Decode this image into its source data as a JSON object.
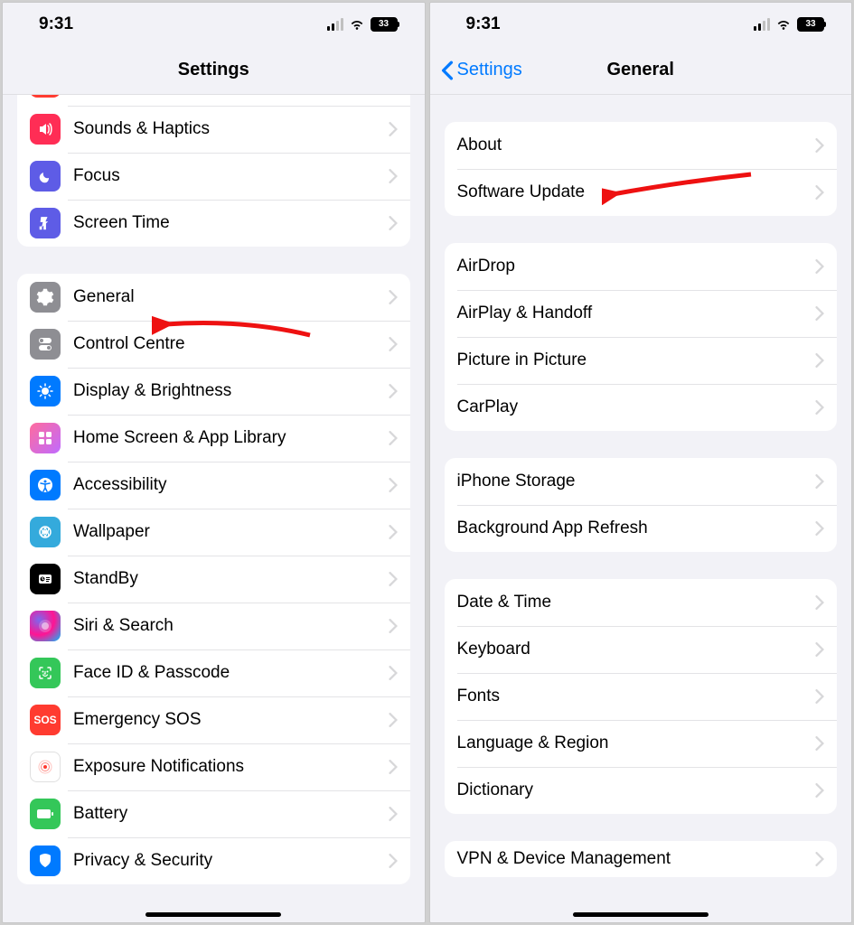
{
  "status": {
    "time": "9:31",
    "battery": "33"
  },
  "left": {
    "title": "Settings",
    "group1": [
      {
        "label": "Sounds & Haptics",
        "icon": "sounds-icon",
        "color": "ic-pink"
      },
      {
        "label": "Focus",
        "icon": "focus-icon",
        "color": "ic-indigo"
      },
      {
        "label": "Screen Time",
        "icon": "screentime-icon",
        "color": "ic-indigo"
      }
    ],
    "group2": [
      {
        "label": "General",
        "icon": "gear-icon",
        "color": "ic-gray"
      },
      {
        "label": "Control Centre",
        "icon": "control-centre-icon",
        "color": "ic-gray"
      },
      {
        "label": "Display & Brightness",
        "icon": "display-icon",
        "color": "ic-blue"
      },
      {
        "label": "Home Screen & App Library",
        "icon": "homescreen-icon",
        "color": "ic-mauve"
      },
      {
        "label": "Accessibility",
        "icon": "accessibility-icon",
        "color": "ic-blue"
      },
      {
        "label": "Wallpaper",
        "icon": "wallpaper-icon",
        "color": "ic-cyan"
      },
      {
        "label": "StandBy",
        "icon": "standby-icon",
        "color": "ic-black"
      },
      {
        "label": "Siri & Search",
        "icon": "siri-icon",
        "color": "ic-siri"
      },
      {
        "label": "Face ID & Passcode",
        "icon": "faceid-icon",
        "color": "ic-green"
      },
      {
        "label": "Emergency SOS",
        "icon": "sos-icon",
        "color": "ic-sos"
      },
      {
        "label": "Exposure Notifications",
        "icon": "exposure-icon",
        "color": "ic-white"
      },
      {
        "label": "Battery",
        "icon": "battery-icon",
        "color": "ic-green"
      },
      {
        "label": "Privacy & Security",
        "icon": "privacy-icon",
        "color": "ic-blue"
      }
    ]
  },
  "right": {
    "back": "Settings",
    "title": "General",
    "group1": [
      {
        "label": "About"
      },
      {
        "label": "Software Update"
      }
    ],
    "group2": [
      {
        "label": "AirDrop"
      },
      {
        "label": "AirPlay & Handoff"
      },
      {
        "label": "Picture in Picture"
      },
      {
        "label": "CarPlay"
      }
    ],
    "group3": [
      {
        "label": "iPhone Storage"
      },
      {
        "label": "Background App Refresh"
      }
    ],
    "group4": [
      {
        "label": "Date & Time"
      },
      {
        "label": "Keyboard"
      },
      {
        "label": "Fonts"
      },
      {
        "label": "Language & Region"
      },
      {
        "label": "Dictionary"
      }
    ],
    "group5": [
      {
        "label": "VPN & Device Management"
      }
    ]
  }
}
